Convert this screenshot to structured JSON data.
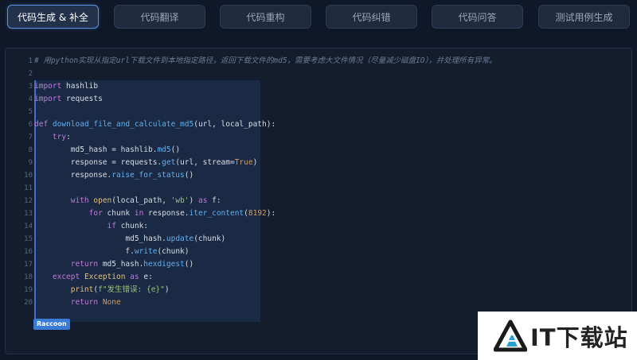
{
  "tabs": [
    {
      "label": "代码生成 & 补全",
      "active": true
    },
    {
      "label": "代码翻译",
      "active": false
    },
    {
      "label": "代码重构",
      "active": false
    },
    {
      "label": "代码纠错",
      "active": false
    },
    {
      "label": "代码问答",
      "active": false
    },
    {
      "label": "测试用例生成",
      "active": false
    }
  ],
  "editor": {
    "line_numbers": [
      "1",
      "2",
      "3",
      "4",
      "5",
      "6",
      "7",
      "8",
      "9",
      "10",
      "11",
      "12",
      "13",
      "14",
      "15",
      "16",
      "17",
      "18",
      "19",
      "20"
    ],
    "comment": "# 用python实现从指定url下载文件到本地指定路径，返回下载文件的md5，需要考虑大文件情况（尽量减少磁盘IO），并处理所有异常。"
  },
  "badge": {
    "label": "Raccoon"
  },
  "watermark": {
    "text": "IT下载站"
  },
  "colors": {
    "accent": "#3a7bd5",
    "background": "#0f1828",
    "active_tab_border": "#5c8fe0"
  }
}
